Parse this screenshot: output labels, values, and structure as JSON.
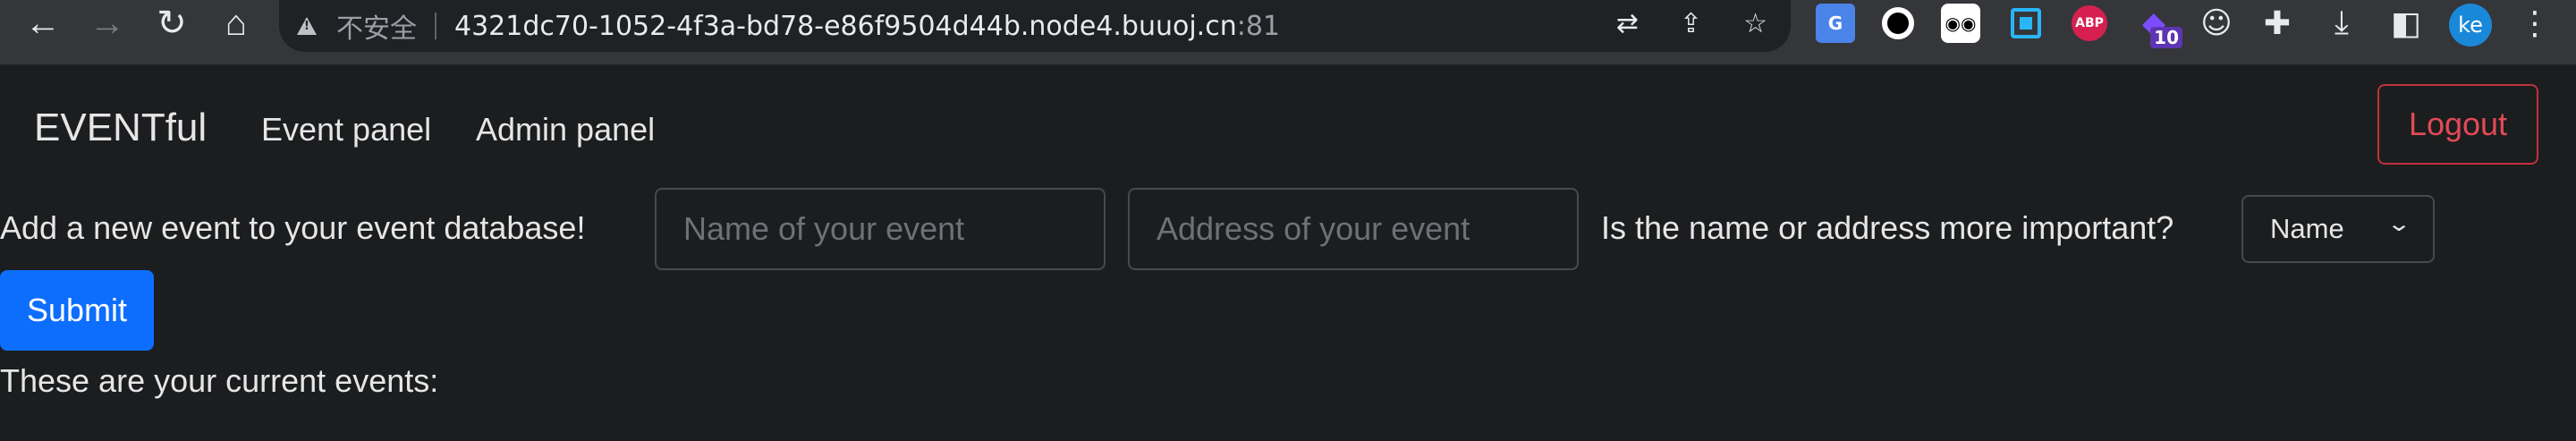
{
  "browser": {
    "insecure_label": "不安全",
    "url_host": "4321dc70-1052-4f3a-bd78-e86f9504d44b.node4.buuoj.cn",
    "url_port": ":81",
    "extension_badge_count": "10",
    "profile_initials": "ke",
    "icons": [
      "back-icon",
      "forward-icon",
      "reload-icon",
      "home-icon",
      "warning-icon",
      "translate-icon",
      "share-icon",
      "star-icon",
      "google-translate-icon",
      "circle-ext-icon",
      "spy-ext-icon",
      "capture-ext-icon",
      "adblock-icon",
      "badge-ext-icon",
      "owl-ext-icon",
      "puzzle-icon",
      "download-icon",
      "sidepanel-icon",
      "menu-icon"
    ]
  },
  "navbar": {
    "brand": "EVENTful",
    "links": [
      "Event panel",
      "Admin panel"
    ],
    "logout_label": "Logout",
    "logout_color": "#dc3545"
  },
  "form": {
    "intro": "Add a new event to your event database!",
    "name_placeholder": "Name of your event",
    "address_placeholder": "Address of your event",
    "importance_question": "Is the name or address more important?",
    "importance_selected": "Name",
    "submit_label": "Submit",
    "submit_color": "#0d6efd"
  },
  "events": {
    "heading": "These are your current events:"
  }
}
